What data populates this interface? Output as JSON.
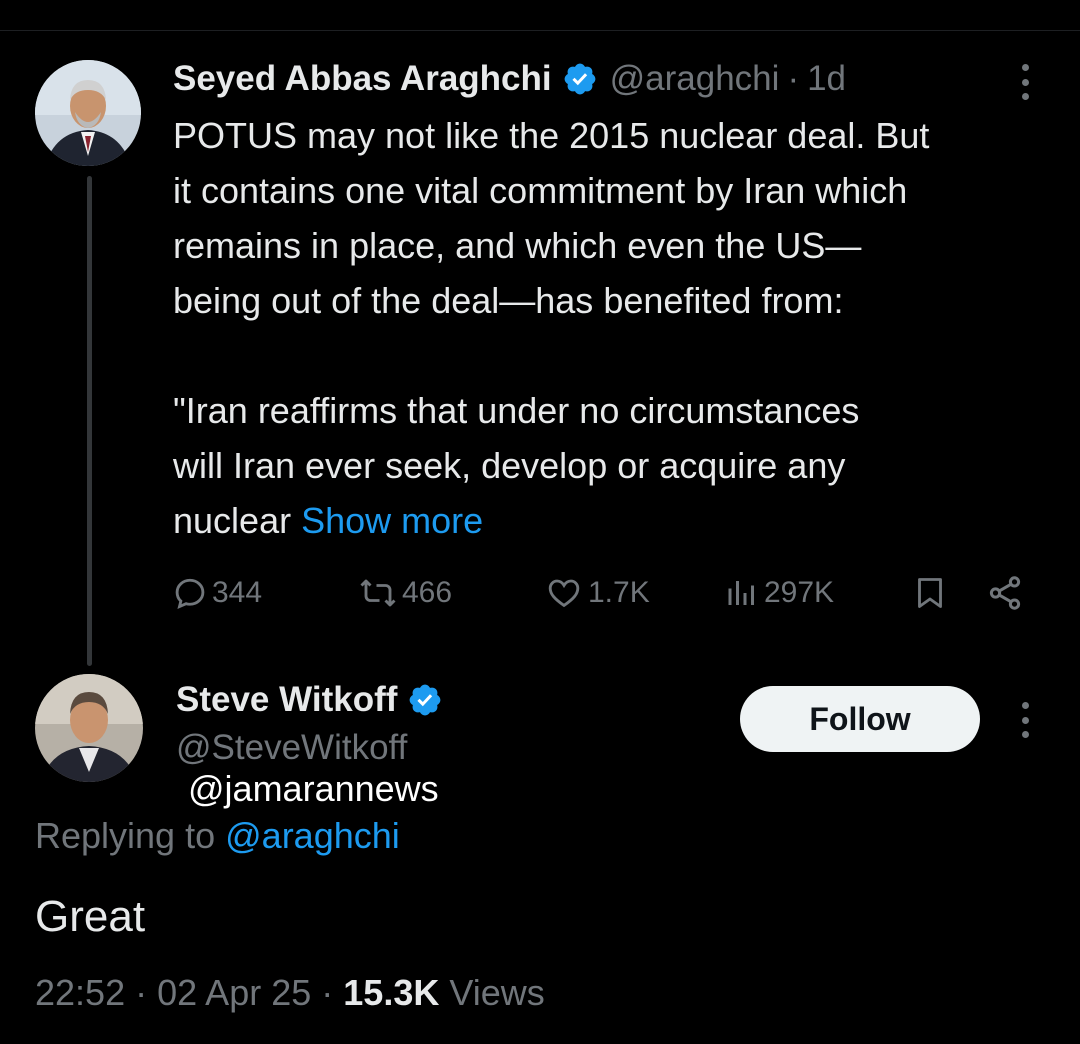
{
  "original_tweet": {
    "author_name": "Seyed Abbas Araghchi",
    "handle": "@araghchi",
    "separator": "·",
    "time": "1d",
    "body": {
      "para1": [
        "POTUS may not like the 2015 nuclear deal. But",
        "it contains one vital commitment by Iran which",
        "remains in place, and which even the US—",
        "being out of the deal—has benefited from:"
      ],
      "para2": [
        "\"Iran reaffirms that under no circumstances",
        "will Iran ever seek, develop or acquire any"
      ],
      "tail": "nuclear",
      "show_more": "Show more"
    },
    "actions": {
      "replies": "344",
      "reposts": "466",
      "likes": "1.7K",
      "views": "297K"
    }
  },
  "reply_tweet": {
    "author_name": "Steve Witkoff",
    "handle": "@SteveWitkoff",
    "follow_label": "Follow",
    "replying_prefix": "Replying to",
    "replying_to": "@araghchi",
    "text": "Great",
    "time": "22:52",
    "date": "02 Apr 25",
    "separator": "·",
    "views_count": "15.3K",
    "views_label": "Views"
  },
  "watermark": "@jamarannews",
  "colors": {
    "background": "#000000",
    "text_primary": "#e7e9ea",
    "text_secondary": "#71767b",
    "accent_blue": "#1d9bf0",
    "follow_button_bg": "#eff3f4"
  },
  "icons": [
    "verified-badge-icon",
    "more-icon",
    "reply-icon",
    "repost-icon",
    "like-icon",
    "views-icon",
    "bookmark-icon",
    "share-icon"
  ]
}
